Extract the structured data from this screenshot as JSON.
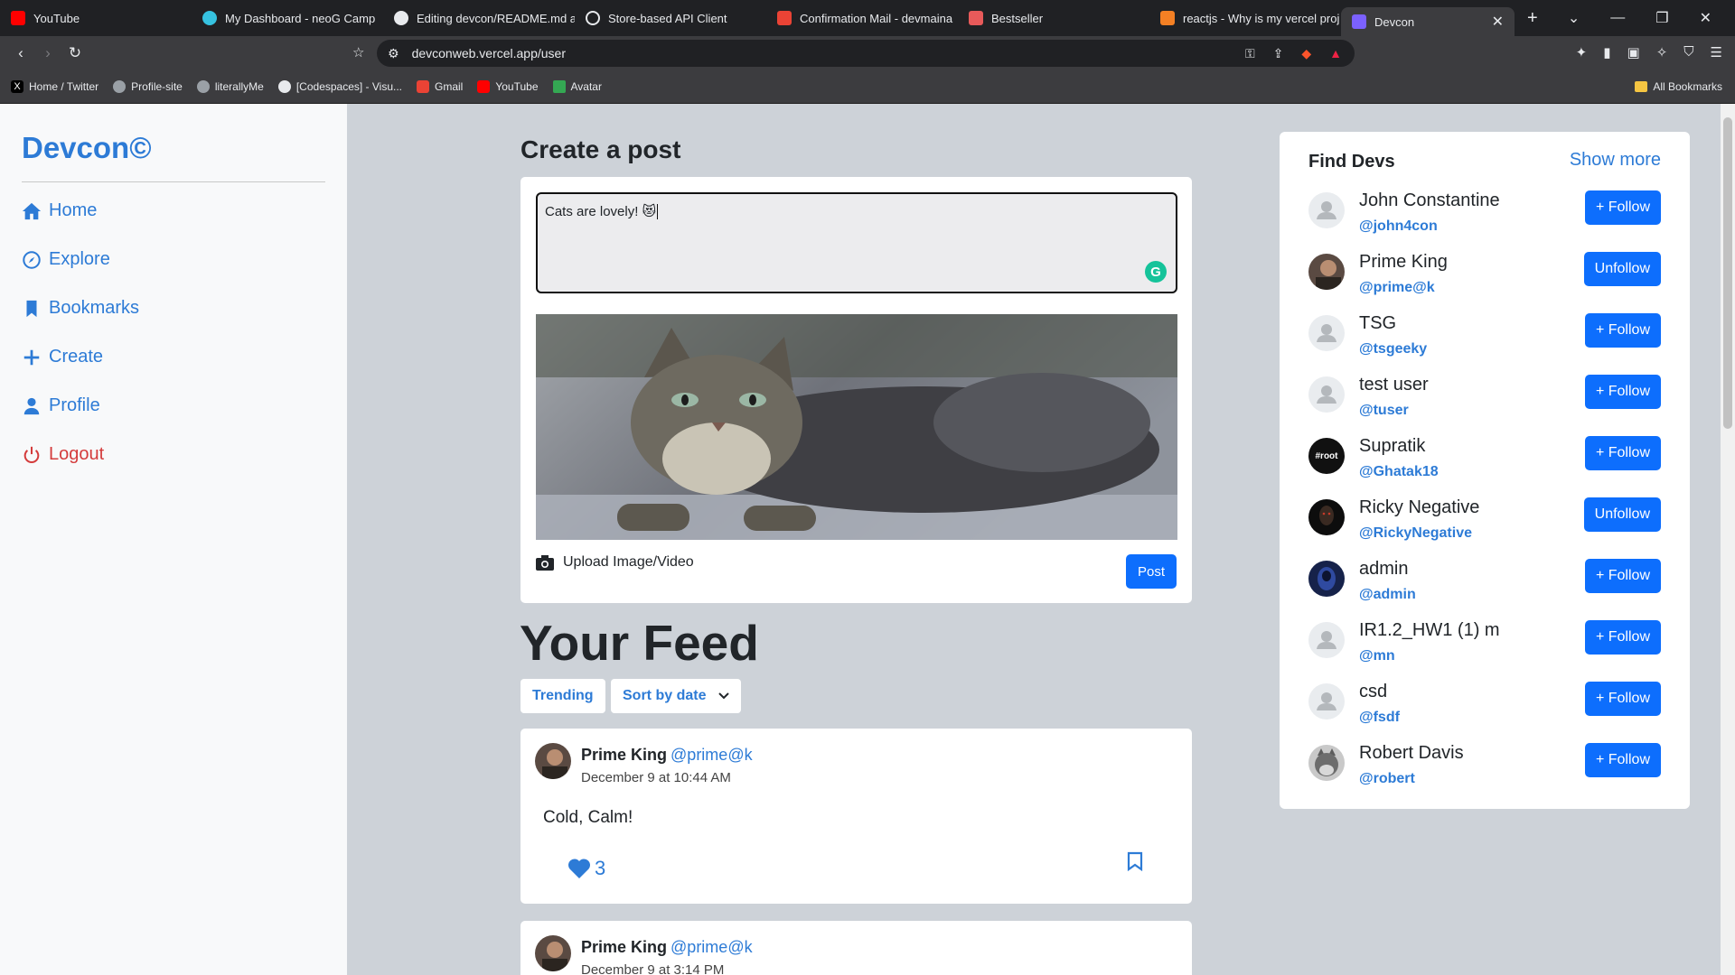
{
  "browser": {
    "tabs": [
      {
        "label": "YouTube",
        "icon": "youtube-icon",
        "color": "#ff0000"
      },
      {
        "label": "My Dashboard - neoG Camp",
        "icon": "neog-icon",
        "color": "#36c2e0"
      },
      {
        "label": "Editing devcon/README.md a",
        "icon": "github-icon",
        "color": "#e8eaed"
      },
      {
        "label": "Store-based API Client",
        "icon": "store-icon",
        "color": "#e8eaed"
      },
      {
        "label": "Confirmation Mail - devmaina",
        "icon": "gmail-icon",
        "color": "#ea4335"
      },
      {
        "label": "Bestseller",
        "icon": "bestseller-icon",
        "color": "#e85a5a"
      },
      {
        "label": "reactjs - Why is my vercel proj",
        "icon": "stackoverflow-icon",
        "color": "#f48024"
      },
      {
        "label": "Devcon",
        "icon": "vercel-icon",
        "color": "#7b61ff",
        "active": true
      }
    ],
    "url": "devconweb.vercel.app/user",
    "bookmarks": [
      {
        "label": "Home / Twitter",
        "icon": "x-icon",
        "color": "#000000"
      },
      {
        "label": "Profile-site",
        "icon": "globe-icon",
        "color": "#9aa0a6"
      },
      {
        "label": "literallyMe",
        "icon": "globe-icon",
        "color": "#9aa0a6"
      },
      {
        "label": "[Codespaces] - Visu...",
        "icon": "github-icon",
        "color": "#e8eaed"
      },
      {
        "label": "Gmail",
        "icon": "gmail-icon",
        "color": "#ea4335"
      },
      {
        "label": "YouTube",
        "icon": "youtube-icon",
        "color": "#ff0000"
      },
      {
        "label": "Avatar",
        "icon": "drive-icon",
        "color": "#34a853"
      }
    ],
    "all_bookmarks": "All Bookmarks"
  },
  "app": {
    "brand": "Devcon©",
    "nav": [
      {
        "label": "Home",
        "icon": "home-icon"
      },
      {
        "label": "Explore",
        "icon": "compass-icon"
      },
      {
        "label": "Bookmarks",
        "icon": "bookmark-icon"
      },
      {
        "label": "Create",
        "icon": "plus-icon"
      },
      {
        "label": "Profile",
        "icon": "user-icon"
      },
      {
        "label": "Logout",
        "icon": "power-icon"
      }
    ],
    "accent": "#2d7bd6",
    "danger": "#d43c3c"
  },
  "create_post": {
    "title": "Create a post",
    "input_value": "Cats are lovely! 😻",
    "upload_label": "Upload Image/Video",
    "post_button": "Post"
  },
  "feed": {
    "title": "Your Feed",
    "trending_label": "Trending",
    "sort_label": "Sort by date",
    "posts": [
      {
        "name": "Prime King",
        "handle": "@prime@k",
        "date": "December 9 at 10:44 AM",
        "body": "Cold, Calm!",
        "likes": "3"
      },
      {
        "name": "Prime King",
        "handle": "@prime@k",
        "date": "December 9 at 3:14 PM"
      }
    ]
  },
  "find_devs": {
    "title": "Find Devs",
    "show_more": "Show more",
    "devs": [
      {
        "name": "John Constantine",
        "handle": "@john4con",
        "action": "+ Follow"
      },
      {
        "name": "Prime King",
        "handle": "@prime@k",
        "action": "Unfollow"
      },
      {
        "name": "TSG",
        "handle": "@tsgeeky",
        "action": "+ Follow"
      },
      {
        "name": "test user",
        "handle": "@tuser",
        "action": "+ Follow"
      },
      {
        "name": "Supratik",
        "handle": "@Ghatak18",
        "action": "+ Follow",
        "avatar_text": "#root"
      },
      {
        "name": "Ricky Negative",
        "handle": "@RickyNegative",
        "action": "Unfollow"
      },
      {
        "name": "admin",
        "handle": "@admin",
        "action": "+ Follow"
      },
      {
        "name": "IR1.2_HW1 (1) m",
        "handle": "@mn",
        "action": "+ Follow"
      },
      {
        "name": "csd",
        "handle": "@fsdf",
        "action": "+ Follow"
      },
      {
        "name": "Robert Davis",
        "handle": "@robert",
        "action": "+ Follow"
      }
    ]
  }
}
